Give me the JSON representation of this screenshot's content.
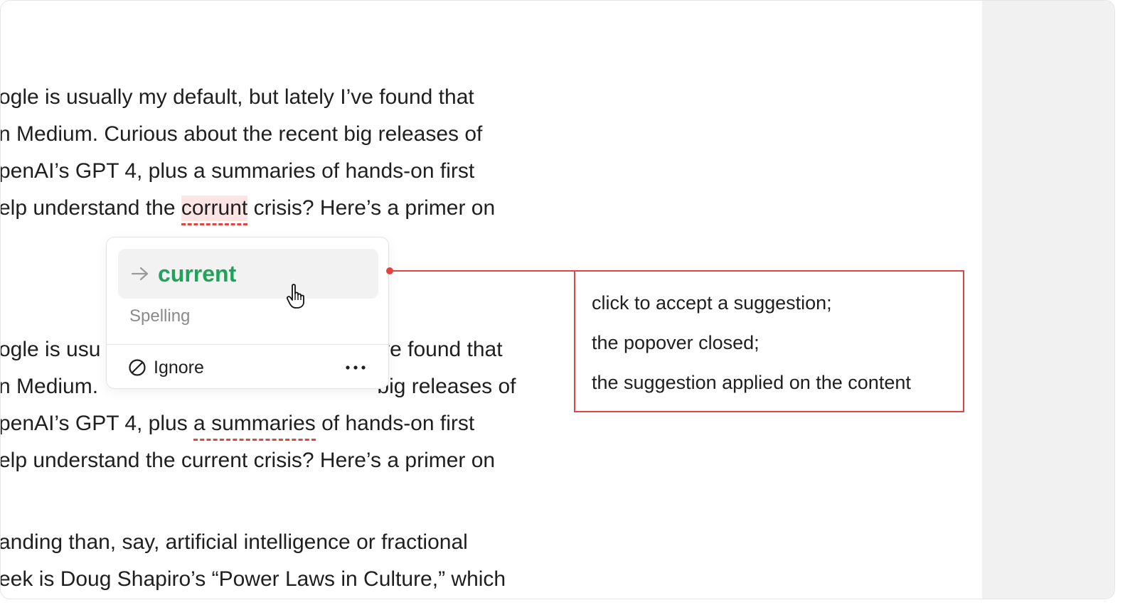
{
  "document": {
    "para1": [
      "ogle is usually my default, but lately I’ve found that",
      "n Medium. Curious about the recent big releases of",
      "penAI’s GPT 4, plus a summaries of hands-on first"
    ],
    "para1_line4_before": "elp understand the ",
    "para1_error_word": "corrunt",
    "para1_line4_after": " crisis? Here’s a primer on",
    "para2_line1_a": "ogle is usu",
    "para2_line1_b": "’ve found that",
    "para2_line2_a": "n Medium. ",
    "para2_line2_b": "big releases of",
    "para2_line3_before": "penAI’s GPT 4, plus ",
    "para2_error_phrase": "a summaries",
    "para2_line3_after": " of hands-on first",
    "para2_line4": "elp understand the current crisis? Here’s a primer on",
    "para3": [
      "anding than, say, artificial intelligence or fractional",
      "eek is Doug Shapiro’s “Power Laws in Culture,” which"
    ]
  },
  "popover": {
    "suggestion": "current",
    "category": "Spelling",
    "ignore_label": "Ignore"
  },
  "annotation": {
    "lines": [
      "click to accept a suggestion;",
      "the popover closed;",
      "the suggestion applied on the content"
    ]
  },
  "colors": {
    "accent_green": "#1fa35a",
    "error_red": "#e04545",
    "error_highlight": "#fde5e5"
  },
  "icons": [
    "arrow-right-icon",
    "hand-cursor-icon",
    "ignore-icon",
    "more-icon"
  ]
}
